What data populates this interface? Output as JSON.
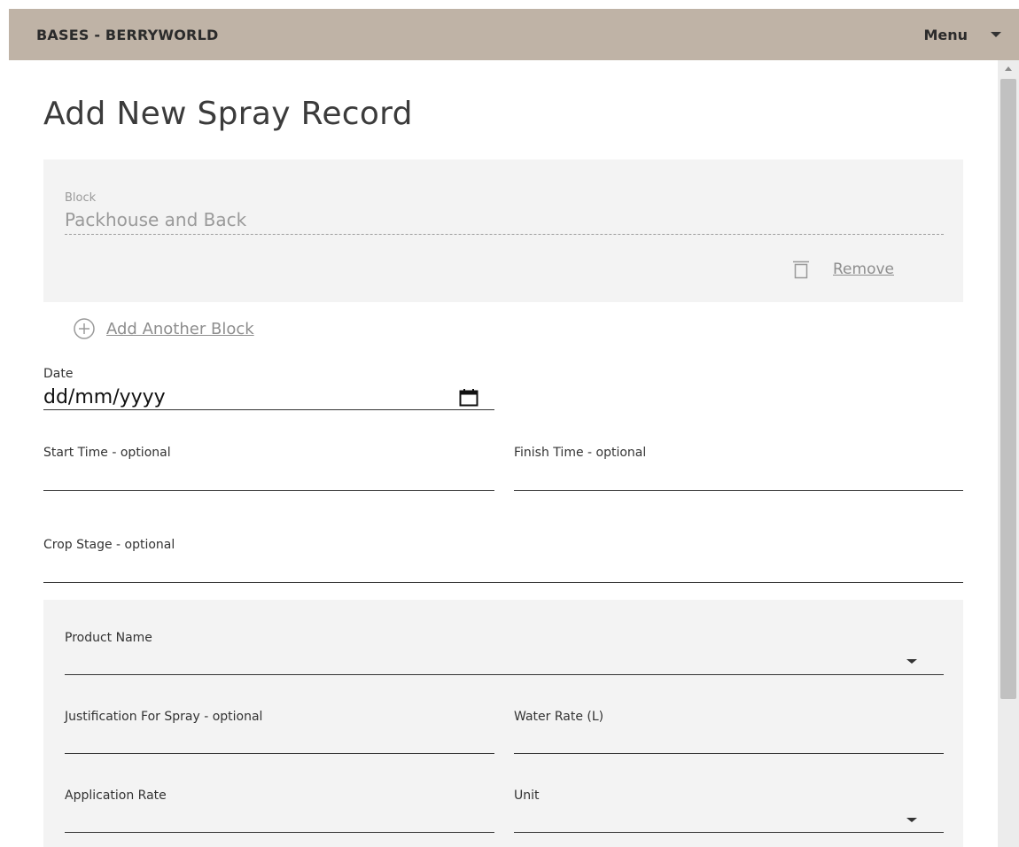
{
  "header": {
    "app_title": "BASES - BERRYWORLD",
    "menu_label": "Menu"
  },
  "page": {
    "title": "Add New Spray Record"
  },
  "block_section": {
    "label": "Block",
    "value": "Packhouse and Back",
    "remove_label": "Remove",
    "add_another_label": "Add Another Block"
  },
  "date": {
    "label": "Date",
    "placeholder": "dd/mm/yyyy"
  },
  "fields": {
    "start_time_label": "Start Time - optional",
    "finish_time_label": "Finish Time - optional",
    "crop_stage_label": "Crop Stage - optional"
  },
  "product_section": {
    "product_name_label": "Product Name",
    "justification_label": "Justification For Spray - optional",
    "water_rate_label": "Water Rate (L)",
    "application_rate_label": "Application Rate",
    "unit_label": "Unit"
  },
  "icons": {
    "menu_caret": "chevron-down-icon",
    "remove": "trash-icon",
    "add_block": "plus-circle-icon",
    "date_picker": "calendar-icon"
  },
  "colors": {
    "header_bg": "#bfb3a6",
    "panel_bg": "#f3f3f3",
    "muted_text": "#8e8e8e"
  }
}
